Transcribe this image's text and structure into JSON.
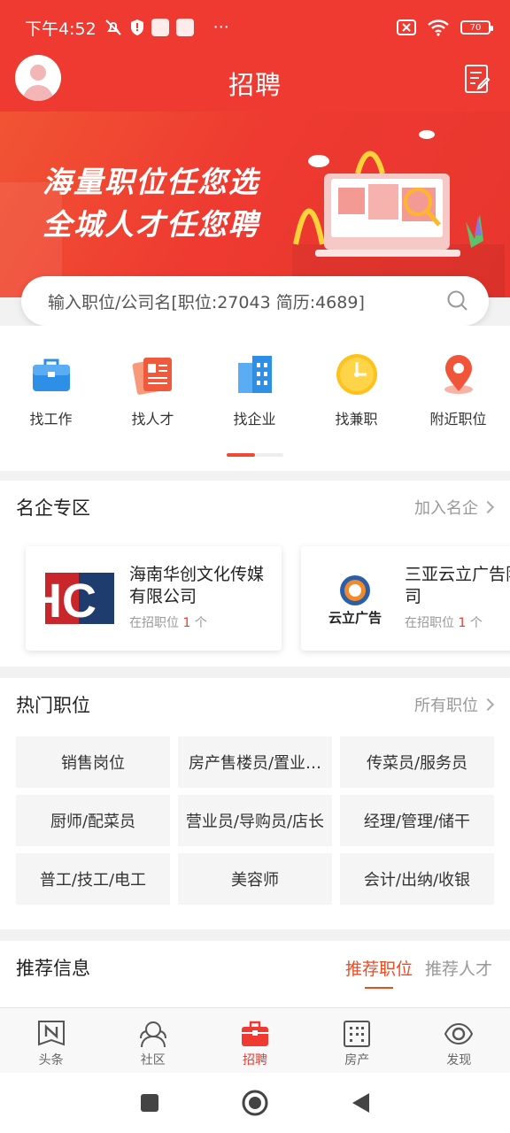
{
  "status_bar": {
    "time": "下午4:52",
    "more": "···",
    "battery": "70"
  },
  "header": {
    "title": "招聘"
  },
  "banner": {
    "line1": "海量职位任您选",
    "line2": "全城人才任您聘"
  },
  "search": {
    "placeholder": "输入职位/公司名[职位:27043 简历:4689]"
  },
  "quick_links": [
    {
      "label": "找工作",
      "icon": "briefcase-icon"
    },
    {
      "label": "找人才",
      "icon": "resume-icon"
    },
    {
      "label": "找企业",
      "icon": "building-icon"
    },
    {
      "label": "找兼职",
      "icon": "clock-icon"
    },
    {
      "label": "附近职位",
      "icon": "location-pin-icon"
    }
  ],
  "famous": {
    "title": "名企专区",
    "more": "加入名企",
    "companies": [
      {
        "name": "海南华创文化传媒有限公司",
        "jobs_label": "在招职位",
        "jobs_count": "1",
        "jobs_unit": "个",
        "logo_text": "HC"
      },
      {
        "name": "三亚云立广告限公司",
        "jobs_label": "在招职位",
        "jobs_count": "1",
        "jobs_unit": "个",
        "logo_text": "云立广告"
      }
    ]
  },
  "hot": {
    "title": "热门职位",
    "more": "所有职位",
    "items": [
      "销售岗位",
      "房产售楼员/置业…",
      "传菜员/服务员",
      "厨师/配菜员",
      "营业员/导购员/店长",
      "经理/管理/储干",
      "普工/技工/电工",
      "美容师",
      "会计/出纳/收银"
    ]
  },
  "recommend": {
    "title": "推荐信息",
    "tabs": [
      "推荐职位",
      "推荐人才"
    ]
  },
  "tabbar": [
    {
      "label": "头条",
      "icon": "news-icon"
    },
    {
      "label": "社区",
      "icon": "community-icon"
    },
    {
      "label": "招聘",
      "icon": "recruit-icon"
    },
    {
      "label": "房产",
      "icon": "building-grid-icon"
    },
    {
      "label": "发现",
      "icon": "eye-icon"
    }
  ],
  "colors": {
    "brand": "#ee3a31",
    "accent": "#ee4a20"
  }
}
